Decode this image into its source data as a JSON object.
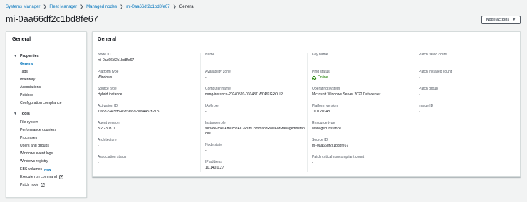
{
  "breadcrumb": {
    "items": [
      "Systems Manager",
      "Fleet Manager",
      "Managed nodes",
      "mi-0aa66df2c1bd8fe67"
    ],
    "current": "General"
  },
  "page": {
    "title": "mi-0aa66df2c1bd8fe67",
    "actions_label": "Node actions"
  },
  "sidebar": {
    "title": "General",
    "properties": {
      "label": "Properties",
      "items": [
        "General",
        "Tags",
        "Inventory",
        "Associations",
        "Patches",
        "Configuration compliance"
      ]
    },
    "tools": {
      "label": "Tools",
      "items": [
        "File system",
        "Performance counters",
        "Processes",
        "Users and groups",
        "Windows event logs",
        "Windows registry",
        "EBS volumes",
        "Execute run command",
        "Patch node"
      ],
      "new_badge": "New"
    }
  },
  "main": {
    "title": "General",
    "col1": [
      {
        "label": "Node ID",
        "value": "mi-0aa66df2c1bd8fe67"
      },
      {
        "label": "Platform type",
        "value": "Windows"
      },
      {
        "label": "Source type",
        "value": "Hybrid instance"
      },
      {
        "label": "Activation ID",
        "value": "1fa58794-5ff8-46ff-9a59-b094482b21b7"
      },
      {
        "label": "Agent version",
        "value": "3.2.2303.0"
      },
      {
        "label": "Architecture",
        "value": "-"
      },
      {
        "label": "Association status",
        "value": "-"
      }
    ],
    "col2": [
      {
        "label": "Name",
        "value": "-"
      },
      {
        "label": "Availability zone",
        "value": "-"
      },
      {
        "label": "Computer name",
        "value": "mmg-instance-20240520-030437.WORKGROUP"
      },
      {
        "label": "IAM role",
        "value": "-"
      },
      {
        "label": "Instance role",
        "value": "service-role/AmazonEC2RunCommandRoleForManagedInstances"
      },
      {
        "label": "Node state",
        "value": "-"
      },
      {
        "label": "IP address",
        "value": "10.140.0.27"
      }
    ],
    "col3": [
      {
        "label": "Key name",
        "value": "-"
      },
      {
        "label": "Ping status",
        "value": "Online"
      },
      {
        "label": "Operating system",
        "value": "Microsoft Windows Server 2022 Datacenter"
      },
      {
        "label": "Platform version",
        "value": "10.0.20348"
      },
      {
        "label": "Resource type",
        "value": "Managed instance"
      },
      {
        "label": "Source ID",
        "value": "mi-0aa66df2c1bd8fe67"
      },
      {
        "label": "Patch critical noncompliant count",
        "value": "-"
      }
    ],
    "col4": [
      {
        "label": "Patch failed count",
        "value": "-"
      },
      {
        "label": "Patch installed count",
        "value": "-"
      },
      {
        "label": "Patch group",
        "value": "-"
      },
      {
        "label": "Image ID",
        "value": "-"
      }
    ]
  },
  "colors": {
    "link": "#0073bb",
    "online": "#1d8102",
    "background": "#f2f3f3",
    "panel": "#ffffff"
  },
  "icons": {
    "breadcrumb_separator": "chevron-right-icon",
    "actions_caret": "caret-down-icon",
    "group_toggle": "caret-down-icon",
    "external_link": "external-link-icon",
    "status": "check-circle-icon"
  }
}
